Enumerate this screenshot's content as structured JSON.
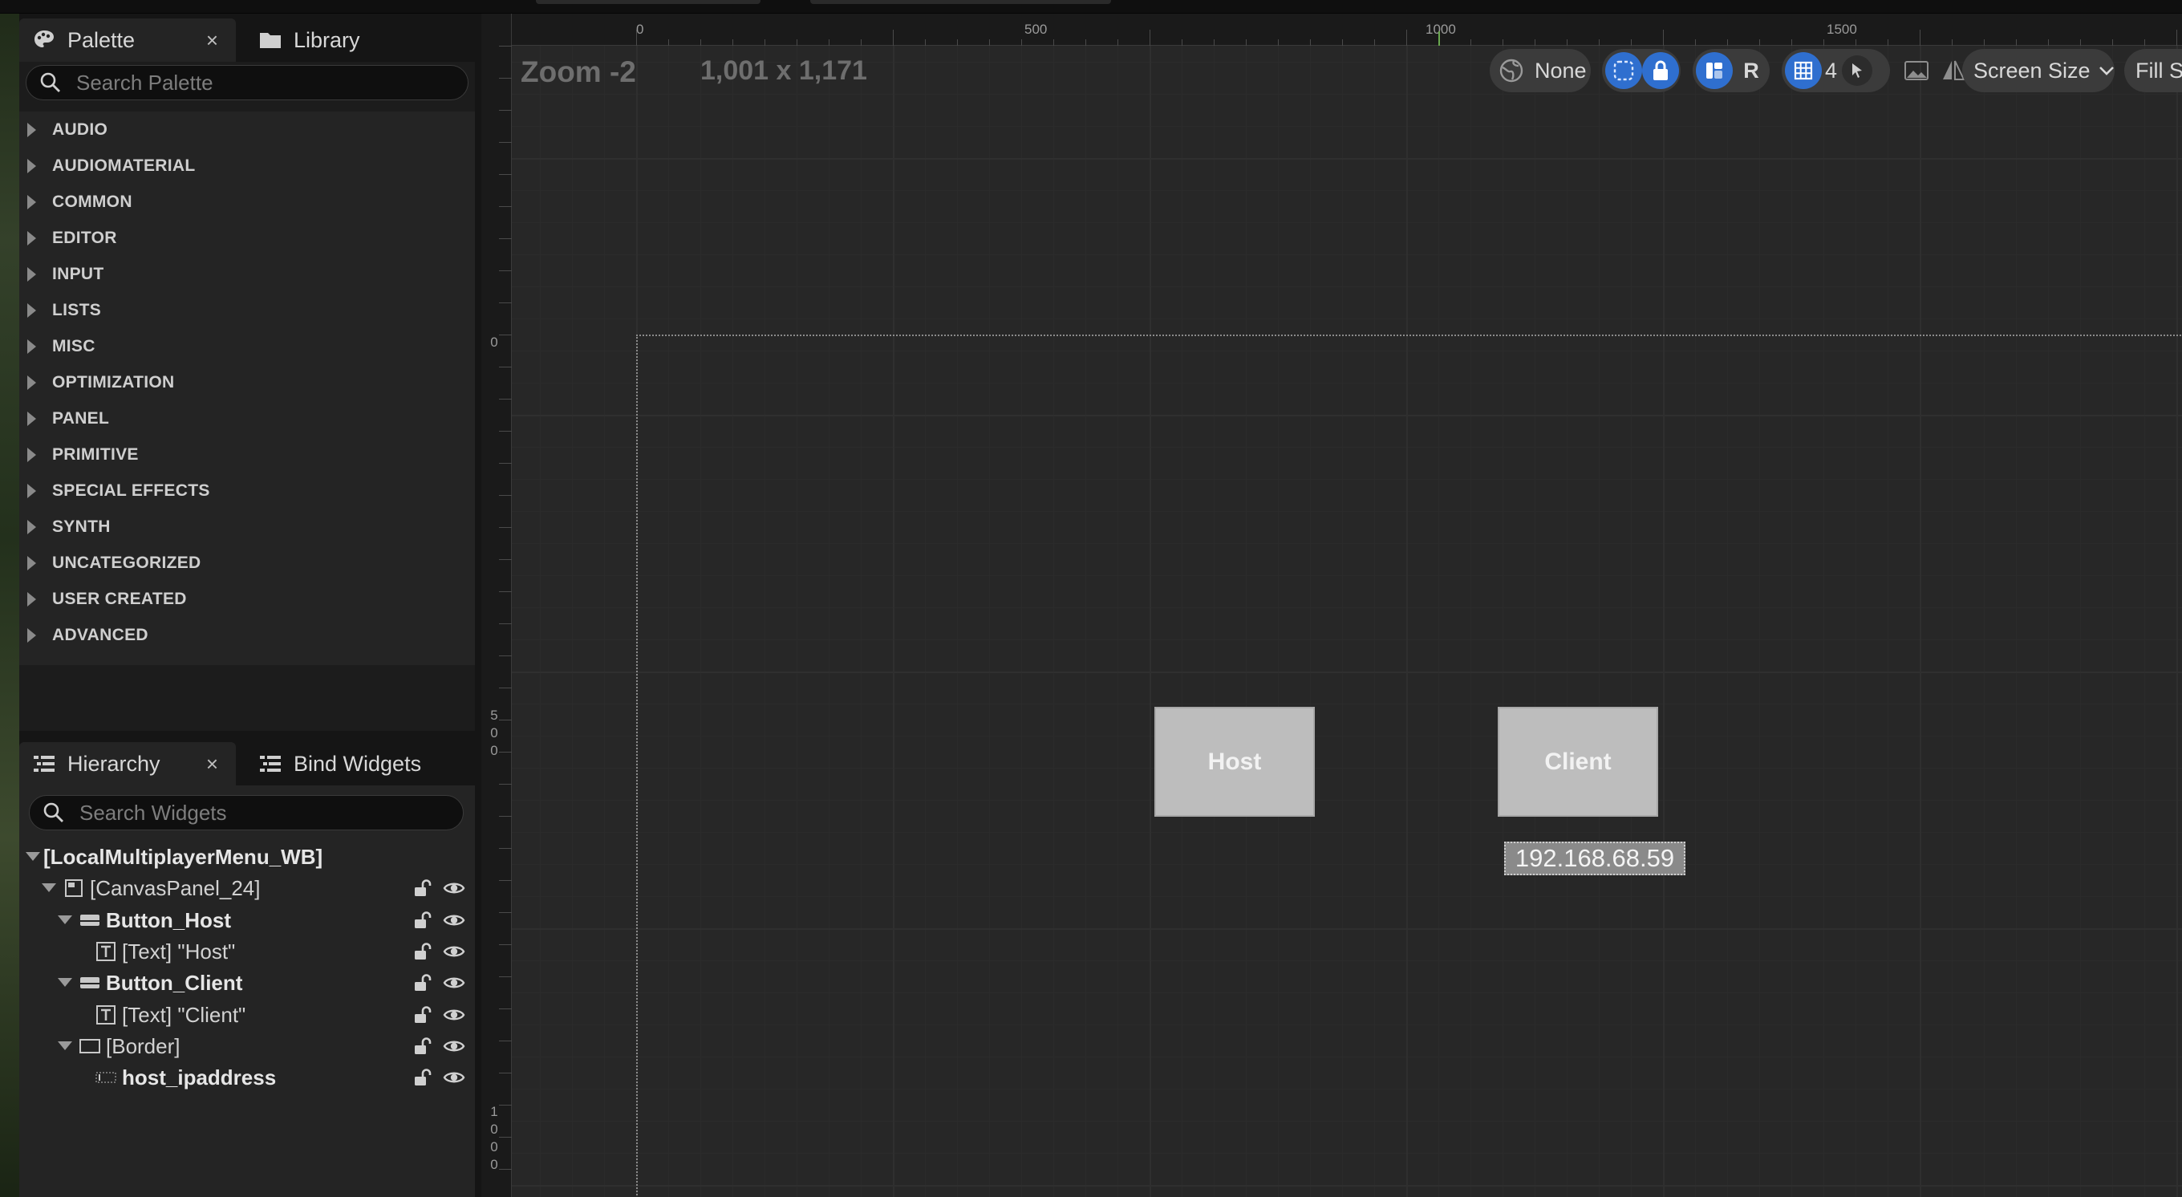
{
  "palette": {
    "tab_label": "Palette",
    "library_tab_label": "Library",
    "close_glyph": "×",
    "search_placeholder": "Search Palette",
    "categories": [
      "AUDIO",
      "AUDIOMATERIAL",
      "COMMON",
      "EDITOR",
      "INPUT",
      "LISTS",
      "MISC",
      "OPTIMIZATION",
      "PANEL",
      "PRIMITIVE",
      "SPECIAL EFFECTS",
      "SYNTH",
      "UNCATEGORIZED",
      "USER CREATED",
      "ADVANCED"
    ]
  },
  "hierarchy": {
    "tab_label": "Hierarchy",
    "bind_tab_label": "Bind Widgets",
    "close_glyph": "×",
    "search_placeholder": "Search Widgets",
    "nodes": [
      {
        "label": "[LocalMultiplayerMenu_WB]",
        "icon": "none",
        "bold": true,
        "expanded": true
      },
      {
        "label": "[CanvasPanel_24]",
        "icon": "canvas-panel-icon",
        "bold": false,
        "expanded": true
      },
      {
        "label": "Button_Host",
        "icon": "button-widget-icon",
        "bold": true,
        "expanded": true
      },
      {
        "label": "[Text] \"Host\"",
        "icon": "text-widget-icon",
        "bold": false,
        "expanded": false
      },
      {
        "label": "Button_Client",
        "icon": "button-widget-icon",
        "bold": true,
        "expanded": true
      },
      {
        "label": "[Text] \"Client\"",
        "icon": "text-widget-icon",
        "bold": false,
        "expanded": false
      },
      {
        "label": "[Border]",
        "icon": "border-widget-icon",
        "bold": false,
        "expanded": true
      },
      {
        "label": "host_ipaddress",
        "icon": "editable-text-icon",
        "bold": true,
        "expanded": false
      }
    ]
  },
  "designer": {
    "zoom_label": "Zoom -2",
    "resolution_label": "1,001 x 1,171",
    "ruler_top": [
      "0",
      "500",
      "1000",
      "1500"
    ],
    "ruler_left": [
      "0",
      "500",
      "1000"
    ],
    "toolbar": {
      "localization_label": "None",
      "respect_locks_label": "R",
      "grid_snap_value": "4",
      "screen_size_label": "Screen Size",
      "fill_label": "Fill Sc"
    },
    "canvas": {
      "host_button_text": "Host",
      "client_button_text": "Client",
      "ip_address_text": "192.168.68.59"
    }
  },
  "colors": {
    "accent_blue": "#2f6fcf",
    "panel_bg": "#242424",
    "viewport_bg": "#272727"
  }
}
